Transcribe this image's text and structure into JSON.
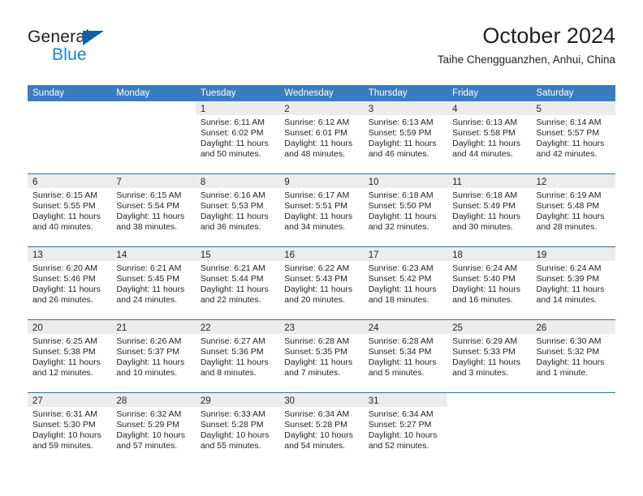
{
  "brand": {
    "name_top": "General",
    "name_bottom": "Blue",
    "triangle_color": "#1061a8",
    "blue_text_color": "#1b7fd4"
  },
  "header": {
    "title": "October 2024",
    "subtitle": "Taihe Chengguanzhen, Anhui, China"
  },
  "colors": {
    "header_blue": "#3a7cc0",
    "week_rule": "#2f6fad",
    "daynum_band": "#ececec",
    "text": "#231f20"
  },
  "weekdays": [
    "Sunday",
    "Monday",
    "Tuesday",
    "Wednesday",
    "Thursday",
    "Friday",
    "Saturday"
  ],
  "weeks": [
    [
      {
        "day": "",
        "sunrise": "",
        "sunset": "",
        "daylight": "",
        "empty": true
      },
      {
        "day": "",
        "sunrise": "",
        "sunset": "",
        "daylight": "",
        "empty": true
      },
      {
        "day": "1",
        "sunrise": "Sunrise: 6:11 AM",
        "sunset": "Sunset: 6:02 PM",
        "daylight": "Daylight: 11 hours and 50 minutes."
      },
      {
        "day": "2",
        "sunrise": "Sunrise: 6:12 AM",
        "sunset": "Sunset: 6:01 PM",
        "daylight": "Daylight: 11 hours and 48 minutes."
      },
      {
        "day": "3",
        "sunrise": "Sunrise: 6:13 AM",
        "sunset": "Sunset: 5:59 PM",
        "daylight": "Daylight: 11 hours and 46 minutes."
      },
      {
        "day": "4",
        "sunrise": "Sunrise: 6:13 AM",
        "sunset": "Sunset: 5:58 PM",
        "daylight": "Daylight: 11 hours and 44 minutes."
      },
      {
        "day": "5",
        "sunrise": "Sunrise: 6:14 AM",
        "sunset": "Sunset: 5:57 PM",
        "daylight": "Daylight: 11 hours and 42 minutes."
      }
    ],
    [
      {
        "day": "6",
        "sunrise": "Sunrise: 6:15 AM",
        "sunset": "Sunset: 5:55 PM",
        "daylight": "Daylight: 11 hours and 40 minutes."
      },
      {
        "day": "7",
        "sunrise": "Sunrise: 6:15 AM",
        "sunset": "Sunset: 5:54 PM",
        "daylight": "Daylight: 11 hours and 38 minutes."
      },
      {
        "day": "8",
        "sunrise": "Sunrise: 6:16 AM",
        "sunset": "Sunset: 5:53 PM",
        "daylight": "Daylight: 11 hours and 36 minutes."
      },
      {
        "day": "9",
        "sunrise": "Sunrise: 6:17 AM",
        "sunset": "Sunset: 5:51 PM",
        "daylight": "Daylight: 11 hours and 34 minutes."
      },
      {
        "day": "10",
        "sunrise": "Sunrise: 6:18 AM",
        "sunset": "Sunset: 5:50 PM",
        "daylight": "Daylight: 11 hours and 32 minutes."
      },
      {
        "day": "11",
        "sunrise": "Sunrise: 6:18 AM",
        "sunset": "Sunset: 5:49 PM",
        "daylight": "Daylight: 11 hours and 30 minutes."
      },
      {
        "day": "12",
        "sunrise": "Sunrise: 6:19 AM",
        "sunset": "Sunset: 5:48 PM",
        "daylight": "Daylight: 11 hours and 28 minutes."
      }
    ],
    [
      {
        "day": "13",
        "sunrise": "Sunrise: 6:20 AM",
        "sunset": "Sunset: 5:46 PM",
        "daylight": "Daylight: 11 hours and 26 minutes."
      },
      {
        "day": "14",
        "sunrise": "Sunrise: 6:21 AM",
        "sunset": "Sunset: 5:45 PM",
        "daylight": "Daylight: 11 hours and 24 minutes."
      },
      {
        "day": "15",
        "sunrise": "Sunrise: 6:21 AM",
        "sunset": "Sunset: 5:44 PM",
        "daylight": "Daylight: 11 hours and 22 minutes."
      },
      {
        "day": "16",
        "sunrise": "Sunrise: 6:22 AM",
        "sunset": "Sunset: 5:43 PM",
        "daylight": "Daylight: 11 hours and 20 minutes."
      },
      {
        "day": "17",
        "sunrise": "Sunrise: 6:23 AM",
        "sunset": "Sunset: 5:42 PM",
        "daylight": "Daylight: 11 hours and 18 minutes."
      },
      {
        "day": "18",
        "sunrise": "Sunrise: 6:24 AM",
        "sunset": "Sunset: 5:40 PM",
        "daylight": "Daylight: 11 hours and 16 minutes."
      },
      {
        "day": "19",
        "sunrise": "Sunrise: 6:24 AM",
        "sunset": "Sunset: 5:39 PM",
        "daylight": "Daylight: 11 hours and 14 minutes."
      }
    ],
    [
      {
        "day": "20",
        "sunrise": "Sunrise: 6:25 AM",
        "sunset": "Sunset: 5:38 PM",
        "daylight": "Daylight: 11 hours and 12 minutes."
      },
      {
        "day": "21",
        "sunrise": "Sunrise: 6:26 AM",
        "sunset": "Sunset: 5:37 PM",
        "daylight": "Daylight: 11 hours and 10 minutes."
      },
      {
        "day": "22",
        "sunrise": "Sunrise: 6:27 AM",
        "sunset": "Sunset: 5:36 PM",
        "daylight": "Daylight: 11 hours and 8 minutes."
      },
      {
        "day": "23",
        "sunrise": "Sunrise: 6:28 AM",
        "sunset": "Sunset: 5:35 PM",
        "daylight": "Daylight: 11 hours and 7 minutes."
      },
      {
        "day": "24",
        "sunrise": "Sunrise: 6:28 AM",
        "sunset": "Sunset: 5:34 PM",
        "daylight": "Daylight: 11 hours and 5 minutes."
      },
      {
        "day": "25",
        "sunrise": "Sunrise: 6:29 AM",
        "sunset": "Sunset: 5:33 PM",
        "daylight": "Daylight: 11 hours and 3 minutes."
      },
      {
        "day": "26",
        "sunrise": "Sunrise: 6:30 AM",
        "sunset": "Sunset: 5:32 PM",
        "daylight": "Daylight: 11 hours and 1 minute."
      }
    ],
    [
      {
        "day": "27",
        "sunrise": "Sunrise: 6:31 AM",
        "sunset": "Sunset: 5:30 PM",
        "daylight": "Daylight: 10 hours and 59 minutes."
      },
      {
        "day": "28",
        "sunrise": "Sunrise: 6:32 AM",
        "sunset": "Sunset: 5:29 PM",
        "daylight": "Daylight: 10 hours and 57 minutes."
      },
      {
        "day": "29",
        "sunrise": "Sunrise: 6:33 AM",
        "sunset": "Sunset: 5:28 PM",
        "daylight": "Daylight: 10 hours and 55 minutes."
      },
      {
        "day": "30",
        "sunrise": "Sunrise: 6:34 AM",
        "sunset": "Sunset: 5:28 PM",
        "daylight": "Daylight: 10 hours and 54 minutes."
      },
      {
        "day": "31",
        "sunrise": "Sunrise: 6:34 AM",
        "sunset": "Sunset: 5:27 PM",
        "daylight": "Daylight: 10 hours and 52 minutes."
      },
      {
        "day": "",
        "sunrise": "",
        "sunset": "",
        "daylight": "",
        "empty": true
      },
      {
        "day": "",
        "sunrise": "",
        "sunset": "",
        "daylight": "",
        "empty": true
      }
    ]
  ]
}
